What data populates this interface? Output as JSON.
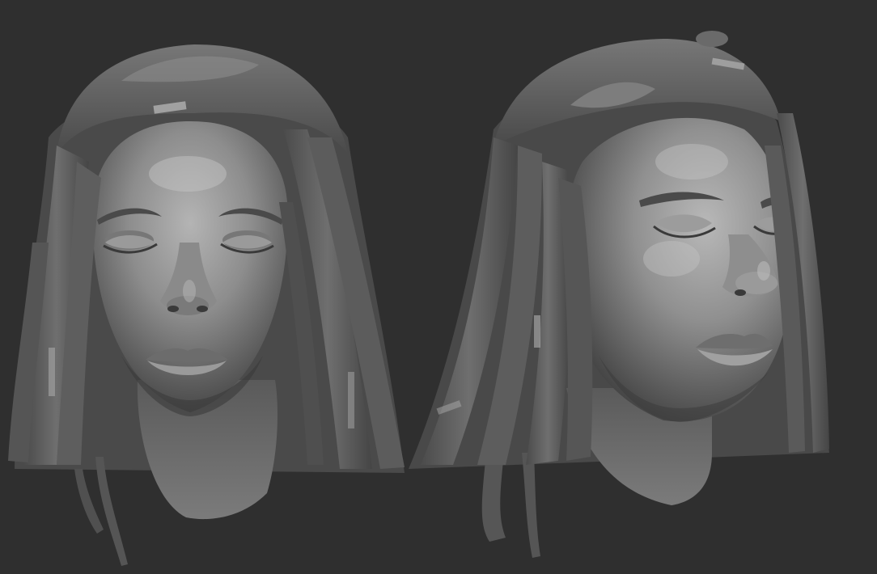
{
  "scene": {
    "background_color": "#2f2f2f",
    "clay_color": "#8a8a8a",
    "subjects": [
      {
        "view": "front",
        "icon": "sculpted-head-front-icon"
      },
      {
        "view": "three-quarter",
        "icon": "sculpted-head-three-quarter-icon"
      }
    ]
  }
}
